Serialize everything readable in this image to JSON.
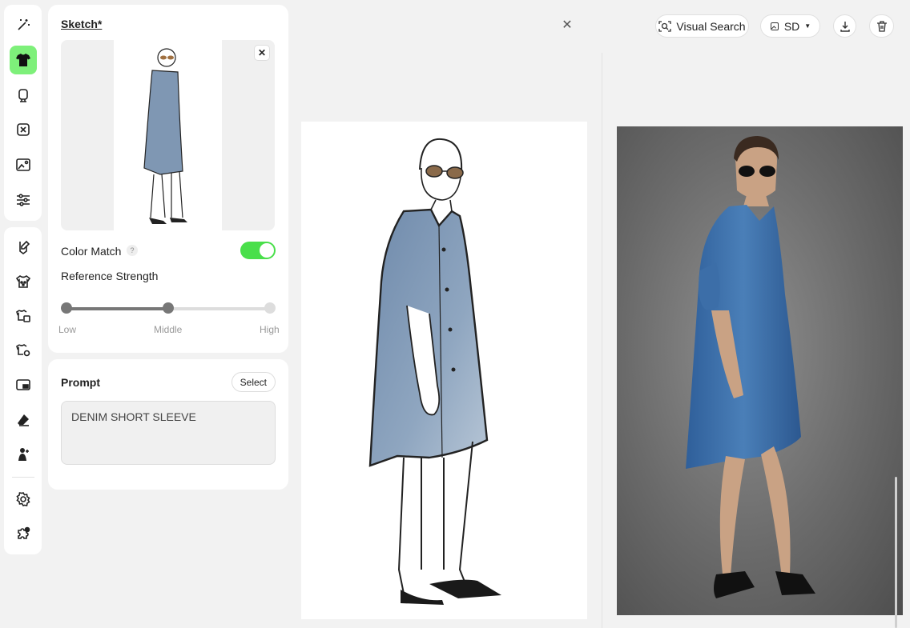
{
  "rail": {
    "top_items": [
      {
        "name": "magic-wand-icon",
        "active": false
      },
      {
        "name": "shirt-icon",
        "active": true
      },
      {
        "name": "mannequin-icon",
        "active": false
      },
      {
        "name": "resize-icon",
        "active": false
      },
      {
        "name": "image-text-icon",
        "active": false
      },
      {
        "name": "sliders-icon",
        "active": false
      }
    ],
    "bottom_items": [
      {
        "name": "pen-edit-icon"
      },
      {
        "name": "pattern-icon"
      },
      {
        "name": "garment-swap-icon"
      },
      {
        "name": "garment-settings-icon"
      },
      {
        "name": "picture-in-picture-icon"
      },
      {
        "name": "eraser-icon"
      },
      {
        "name": "model-add-icon"
      },
      {
        "name": "settings-icon"
      },
      {
        "name": "plugin-icon"
      }
    ]
  },
  "sketch_panel": {
    "title": "Sketch*",
    "color_match_label": "Color Match",
    "help_glyph": "?",
    "color_match_on": true,
    "reference_strength_label": "Reference Strength",
    "slider": {
      "low": "Low",
      "middle": "Middle",
      "high": "High",
      "value": 0.5
    }
  },
  "prompt_panel": {
    "title": "Prompt",
    "select_label": "Select",
    "text": "DENIM SHORT SLEEVE"
  },
  "toolbar": {
    "visual_search_label": "Visual Search",
    "model_label": "SD"
  },
  "colors": {
    "accent": "#49df4a",
    "active_rail": "#7ef07a",
    "denim": "#3f6fa6"
  }
}
